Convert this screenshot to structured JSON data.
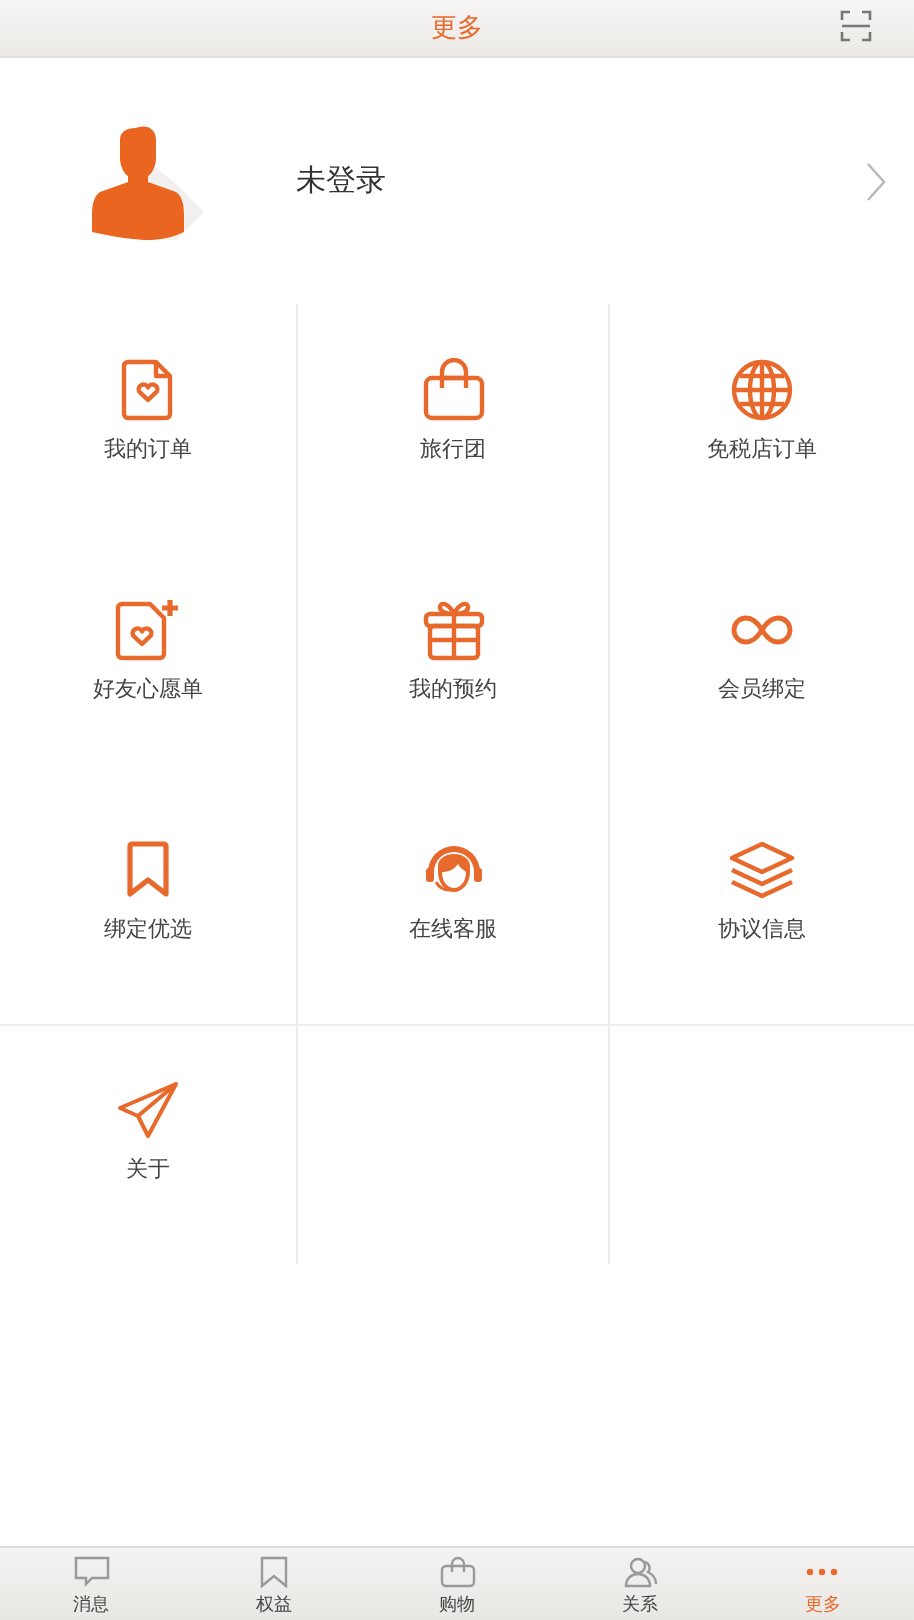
{
  "header": {
    "title": "更多"
  },
  "profile": {
    "name": "未登录"
  },
  "menu": [
    {
      "label": "我的订单"
    },
    {
      "label": "旅行团"
    },
    {
      "label": "免税店订单"
    },
    {
      "label": "好友心愿单"
    },
    {
      "label": "我的预约"
    },
    {
      "label": "会员绑定"
    },
    {
      "label": "绑定优选"
    },
    {
      "label": "在线客服"
    },
    {
      "label": "协议信息"
    },
    {
      "label": "关于"
    }
  ],
  "tab_bar": [
    {
      "label": "消息",
      "selected": false
    },
    {
      "label": "权益",
      "selected": false
    },
    {
      "label": "购物",
      "selected": false
    },
    {
      "label": "关系",
      "selected": false
    },
    {
      "label": "更多",
      "selected": true
    }
  ]
}
